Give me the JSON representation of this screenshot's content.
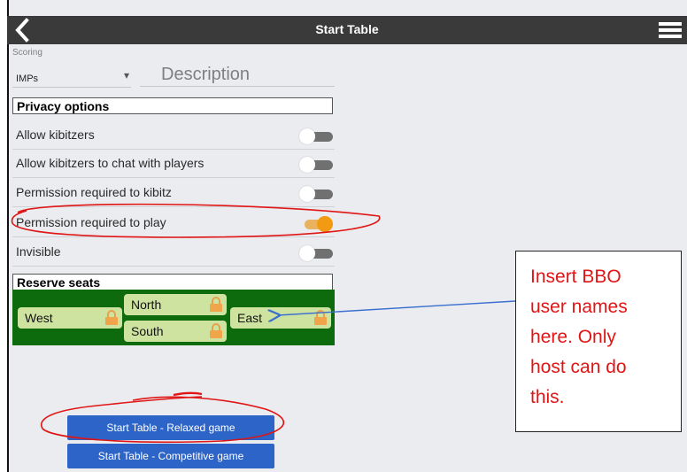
{
  "header": {
    "title": "Start Table",
    "back_icon": "chevron-left-icon",
    "menu_icon": "hamburger-menu-icon"
  },
  "scoring": {
    "label": "Scoring",
    "value": "IMPs",
    "caret": "▾"
  },
  "description": {
    "placeholder": "Description",
    "value": ""
  },
  "privacy": {
    "title": "Privacy options",
    "options": [
      {
        "label": "Allow kibitzers",
        "on": false
      },
      {
        "label": "Allow kibitzers to chat with players",
        "on": false
      },
      {
        "label": "Permission required to kibitz",
        "on": false
      },
      {
        "label": "Permission required to play",
        "on": true
      },
      {
        "label": "Invisible",
        "on": false
      }
    ]
  },
  "reserve": {
    "title": "Reserve seats",
    "seats": {
      "west": "West",
      "north": "North",
      "south": "South",
      "east": "East"
    }
  },
  "buttons": {
    "relaxed": "Start Table - Relaxed game",
    "competitive": "Start Table - Competitive game"
  },
  "callout": {
    "lines": [
      "Insert BBO",
      "user names",
      "here.  Only",
      "host can do",
      "this."
    ]
  },
  "colors": {
    "header": "#3a3a3a",
    "toggle_on": "#f29a12",
    "seat_area": "#0d6b0d",
    "seat": "#cfe3a1",
    "button": "#2d64c8",
    "annotation": "#e01515",
    "arrow": "#3a6fd0"
  }
}
